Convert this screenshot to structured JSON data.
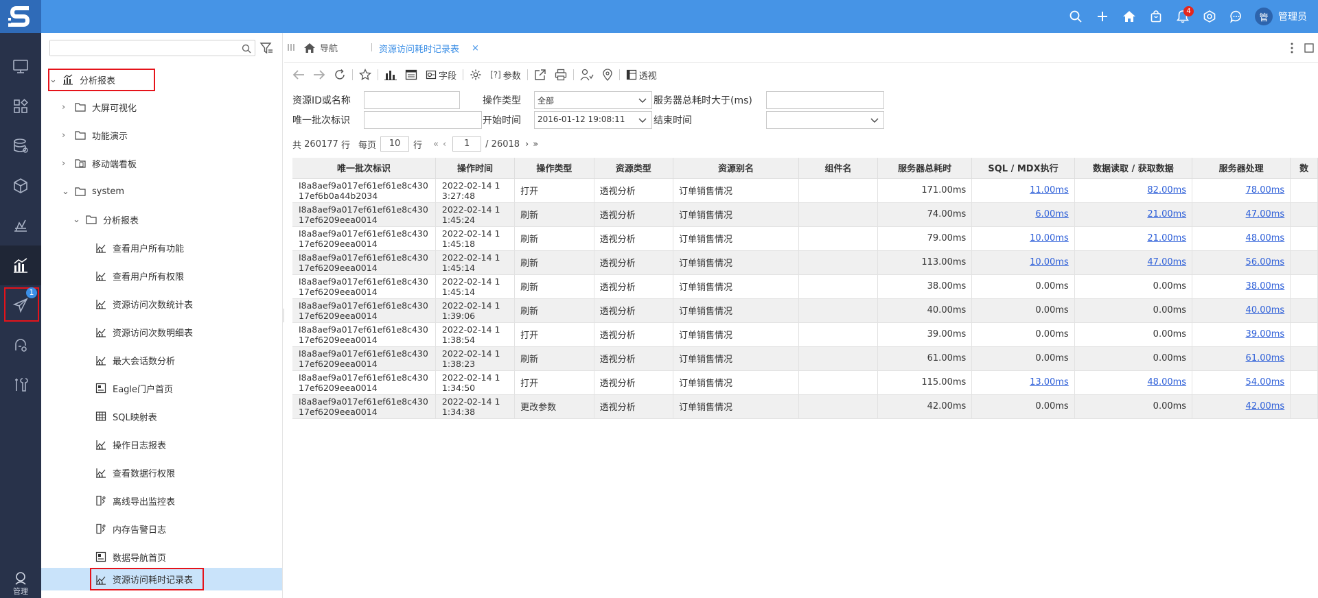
{
  "header": {
    "notification_count": "4",
    "user_avatar_text": "管",
    "user_name": "管理员",
    "brand_color": "#4694e6"
  },
  "leftnav": {
    "active_badge": "1",
    "footer_label": "管理"
  },
  "tree": {
    "search_placeholder": "",
    "nodes": [
      {
        "label": "分析报表"
      },
      {
        "label": "大屏可视化"
      },
      {
        "label": "功能演示"
      },
      {
        "label": "移动端看板"
      },
      {
        "label": "system"
      },
      {
        "label": "分析报表"
      },
      {
        "label": "查看用户所有功能"
      },
      {
        "label": "查看用户所有权限"
      },
      {
        "label": "资源访问次数统计表"
      },
      {
        "label": "资源访问次数明细表"
      },
      {
        "label": "最大会话数分析"
      },
      {
        "label": "Eagle门户首页"
      },
      {
        "label": "SQL映射表"
      },
      {
        "label": "操作日志报表"
      },
      {
        "label": "查看数据行权限"
      },
      {
        "label": "离线导出监控表"
      },
      {
        "label": "内存告警日志"
      },
      {
        "label": "数据导航首页"
      },
      {
        "label": "资源访问耗时记录表"
      }
    ]
  },
  "tabs": {
    "home_label": "导航",
    "active_label": "资源访问耗时记录表",
    "close_glyph": "×"
  },
  "toolbar": {
    "fields_label": "字段",
    "params_label": "参数",
    "params_prefix": "[?]",
    "pivot_label": "透视"
  },
  "filters": {
    "resource_id_label": "资源ID或名称",
    "resource_id_value": "",
    "op_type_label": "操作类型",
    "op_type_value": "全部",
    "server_time_label": "服务器总耗时大于(ms)",
    "server_time_value": "",
    "batch_label": "唯一批次标识",
    "batch_value": "",
    "start_label": "开始时间",
    "start_value": "2016-01-12 19:08:11",
    "end_label": "结束时间",
    "end_value": ""
  },
  "pager": {
    "total_prefix": "共",
    "total": "260177",
    "rows_unit": "行",
    "per_page_label": "每页",
    "per_page": "10",
    "per_page_unit": "行",
    "current_page": "1",
    "total_pages": "/ 26018"
  },
  "table": {
    "columns": [
      "唯一批次标识",
      "操作时间",
      "操作类型",
      "资源类型",
      "资源别名",
      "组件名",
      "服务器总耗时",
      "SQL / MDX执行",
      "数据读取 / 获取数据",
      "服务器处理",
      "数"
    ],
    "rows": [
      {
        "batch": "I8a8aef9a017ef61ef61e8c43017ef6b0a44b2034",
        "time": "2022-02-14 13:27:48",
        "op": "打开",
        "res_type": "透视分析",
        "alias": "订单销售情况",
        "component": "",
        "total": "171.00ms",
        "sql": "11.00ms",
        "read": "82.00ms",
        "server": "78.00ms"
      },
      {
        "batch": "I8a8aef9a017ef61ef61e8c43017ef6209eea0014",
        "time": "2022-02-14 11:45:24",
        "op": "刷新",
        "res_type": "透视分析",
        "alias": "订单销售情况",
        "component": "",
        "total": "74.00ms",
        "sql": "6.00ms",
        "read": "21.00ms",
        "server": "47.00ms"
      },
      {
        "batch": "I8a8aef9a017ef61ef61e8c43017ef6209eea0014",
        "time": "2022-02-14 11:45:18",
        "op": "刷新",
        "res_type": "透视分析",
        "alias": "订单销售情况",
        "component": "",
        "total": "79.00ms",
        "sql": "10.00ms",
        "read": "21.00ms",
        "server": "48.00ms"
      },
      {
        "batch": "I8a8aef9a017ef61ef61e8c43017ef6209eea0014",
        "time": "2022-02-14 11:45:14",
        "op": "刷新",
        "res_type": "透视分析",
        "alias": "订单销售情况",
        "component": "",
        "total": "113.00ms",
        "sql": "10.00ms",
        "read": "47.00ms",
        "server": "56.00ms"
      },
      {
        "batch": "I8a8aef9a017ef61ef61e8c43017ef6209eea0014",
        "time": "2022-02-14 11:45:14",
        "op": "刷新",
        "res_type": "透视分析",
        "alias": "订单销售情况",
        "component": "",
        "total": "38.00ms",
        "sql": "0.00ms",
        "read": "0.00ms",
        "server": "38.00ms"
      },
      {
        "batch": "I8a8aef9a017ef61ef61e8c43017ef6209eea0014",
        "time": "2022-02-14 11:39:06",
        "op": "刷新",
        "res_type": "透视分析",
        "alias": "订单销售情况",
        "component": "",
        "total": "40.00ms",
        "sql": "0.00ms",
        "read": "0.00ms",
        "server": "40.00ms"
      },
      {
        "batch": "I8a8aef9a017ef61ef61e8c43017ef6209eea0014",
        "time": "2022-02-14 11:38:54",
        "op": "打开",
        "res_type": "透视分析",
        "alias": "订单销售情况",
        "component": "",
        "total": "39.00ms",
        "sql": "0.00ms",
        "read": "0.00ms",
        "server": "39.00ms"
      },
      {
        "batch": "I8a8aef9a017ef61ef61e8c43017ef6209eea0014",
        "time": "2022-02-14 11:38:23",
        "op": "刷新",
        "res_type": "透视分析",
        "alias": "订单销售情况",
        "component": "",
        "total": "61.00ms",
        "sql": "0.00ms",
        "read": "0.00ms",
        "server": "61.00ms"
      },
      {
        "batch": "I8a8aef9a017ef61ef61e8c43017ef6209eea0014",
        "time": "2022-02-14 11:34:50",
        "op": "打开",
        "res_type": "透视分析",
        "alias": "订单销售情况",
        "component": "",
        "total": "115.00ms",
        "sql": "13.00ms",
        "read": "48.00ms",
        "server": "54.00ms"
      },
      {
        "batch": "I8a8aef9a017ef61ef61e8c43017ef6209eea0014",
        "time": "2022-02-14 11:34:38",
        "op": "更改参数",
        "res_type": "透视分析",
        "alias": "订单销售情况",
        "component": "",
        "total": "42.00ms",
        "sql": "0.00ms",
        "read": "0.00ms",
        "server": "42.00ms"
      }
    ]
  }
}
